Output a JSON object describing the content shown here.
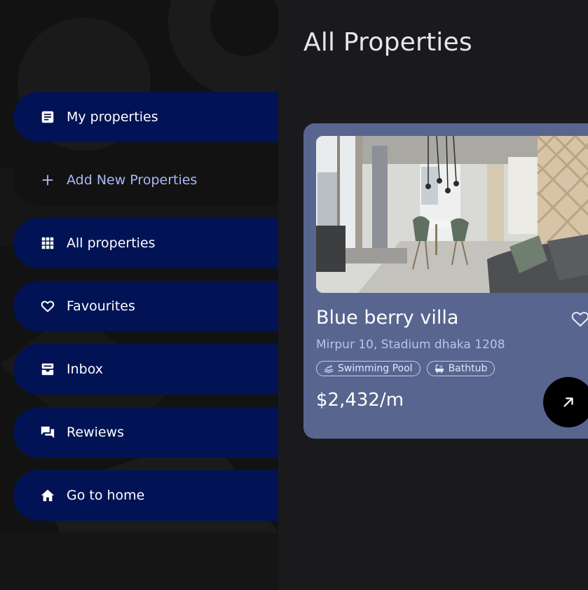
{
  "sidebar": {
    "items": [
      {
        "label": "My properties",
        "icon": "document-list-icon",
        "active": true
      },
      {
        "label": "Add New Properties",
        "icon": "plus-icon",
        "active": false
      },
      {
        "label": "All properties",
        "icon": "grid-icon",
        "active": true
      },
      {
        "label": "Favourites",
        "icon": "heart-icon",
        "active": true
      },
      {
        "label": "Inbox",
        "icon": "inbox-icon",
        "active": true
      },
      {
        "label": "Rewiews",
        "icon": "chat-bubbles-icon",
        "active": true
      },
      {
        "label": "Go to home",
        "icon": "home-icon",
        "active": true
      }
    ]
  },
  "main": {
    "title": "All Properties"
  },
  "property": {
    "name": "Blue berry villa",
    "address": "Mirpur 10, Stadium dhaka 1208",
    "amenities": [
      {
        "label": "Swimming Pool",
        "icon": "swimming-icon"
      },
      {
        "label": "Bathtub",
        "icon": "bathtub-icon"
      }
    ],
    "price": "$2,432/m"
  },
  "colors": {
    "nav_bg": "#011355",
    "card_bg": "#58658f",
    "page_bg": "#1a1a1c",
    "accent_text": "#a9b9f7"
  }
}
